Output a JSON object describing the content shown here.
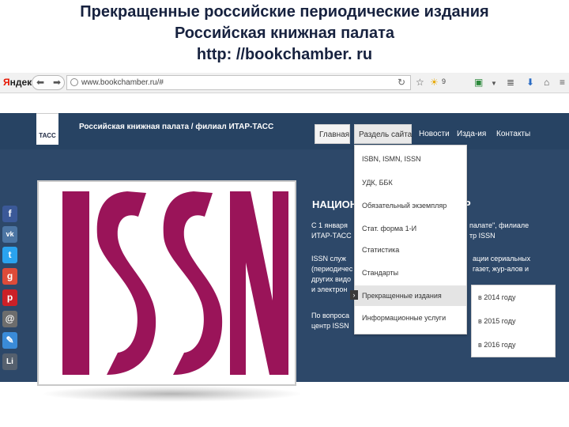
{
  "slide": {
    "title_line1": "Прекращенные российские периодические издания",
    "title_line2": "Российская книжная палата",
    "title_line3": "http: //bookchamber. ru"
  },
  "browser": {
    "logo_letter": "Я",
    "logo_rest": "ндекс",
    "url": "www.bookchamber.ru/#",
    "weather_value": "9",
    "icons": [
      "back-icon",
      "forward-icon",
      "globe-icon",
      "reload-icon",
      "star-icon",
      "sun-icon",
      "shield-icon",
      "dropdown-icon",
      "download-icon",
      "home-icon",
      "menu-icon"
    ]
  },
  "site": {
    "logo_text": "ТАСС",
    "site_name": "Российская книжная палата / филиал ИТАР-ТАСС",
    "nav": [
      "Главная",
      "Раздель сайта",
      "Новости",
      "Изда-ия",
      "Контакты"
    ],
    "dropdown": [
      "ISBN, ISMN, ISSN",
      "УДК, ББК",
      "Обязательный экземпляр",
      "Стат. форма 1-И",
      "Статистика",
      "Стандарты",
      "Прекращенные издания",
      "Информационные услуги"
    ],
    "submenu": [
      "в 2014 году",
      "в 2015 году",
      "в 2016 году"
    ],
    "logo_word": "ISSN",
    "content_title": "НАЦИОН",
    "content_title_end": "Р",
    "paragraph1_line1_start": "С 1 января",
    "paragraph1_line1_end": "палате\", филиале",
    "paragraph1_line2_start": "ИТАР-ТАСС",
    "paragraph1_line2_end": "тр ISSN",
    "paragraph2_line1_start": "ISSN служ",
    "paragraph2_line1_end": "ации сериальных",
    "paragraph2_line2_start": "(периодичес",
    "paragraph2_line2_end": "газет, жур-алов и",
    "paragraph2_line3_start": "других видо",
    "paragraph2_line4_start": "и электрон",
    "paragraph3_line1_start": "По вопроса",
    "paragraph3_line2_start": "центр ISSN",
    "colors": {
      "issn_logo": "#9a1459",
      "site_background": "#2d4869",
      "header_background": "#274363"
    }
  },
  "social": [
    {
      "name": "facebook-icon",
      "glyph": "f",
      "color": "#3b5998"
    },
    {
      "name": "vkontakte-icon",
      "glyph": "vk",
      "color": "#4c75a3"
    },
    {
      "name": "twitter-icon",
      "glyph": "t",
      "color": "#2aa3ef"
    },
    {
      "name": "google-plus-icon",
      "glyph": "g",
      "color": "#dd4b39"
    },
    {
      "name": "pinterest-icon",
      "glyph": "p",
      "color": "#cb2027"
    },
    {
      "name": "email-icon",
      "glyph": "@",
      "color": "#6d6d6d"
    },
    {
      "name": "bookmark-icon",
      "glyph": "✎",
      "color": "#3a8bd8"
    },
    {
      "name": "livejournal-icon",
      "glyph": "Li",
      "color": "#55606e"
    }
  ]
}
